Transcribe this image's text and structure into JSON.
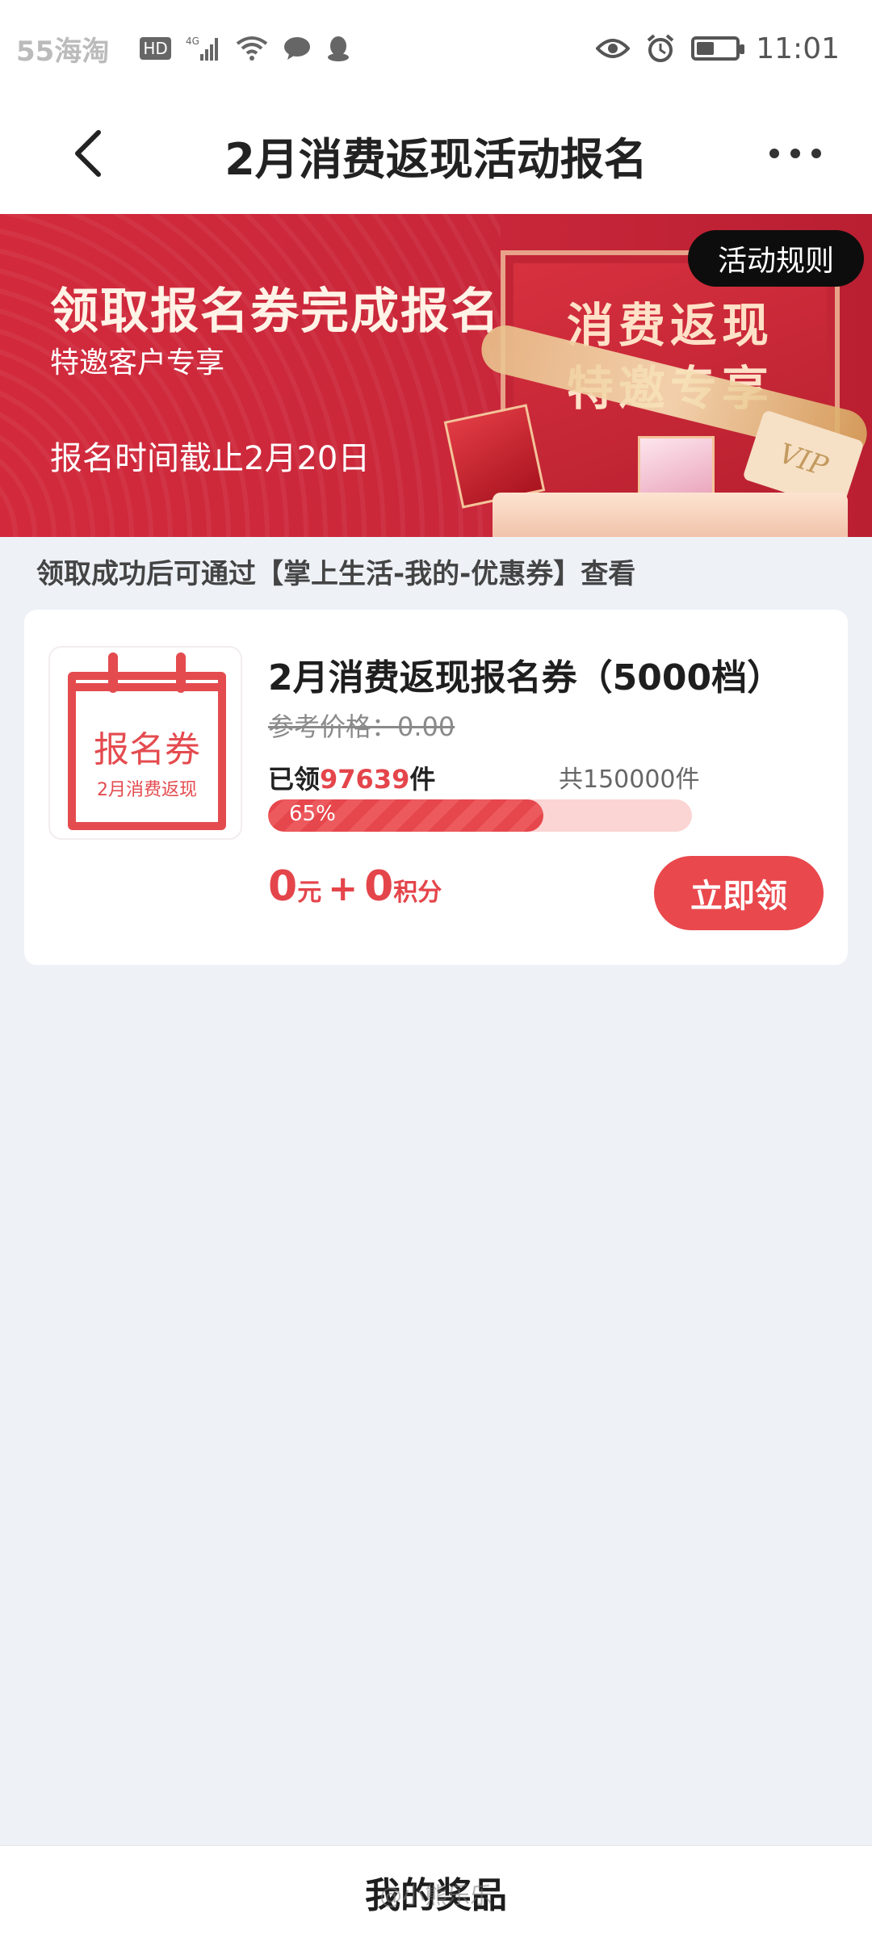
{
  "status_bar": {
    "watermark": "55海淘",
    "hd": "HD",
    "network": "4G",
    "time": "11:01",
    "battery_level": 0.45
  },
  "nav": {
    "title": "2月消费返现活动报名",
    "back_icon": "chevron-left-icon",
    "more_icon": "more-dots-icon"
  },
  "banner": {
    "headline": "领取报名券完成报名",
    "subtitle": "特邀客户专享",
    "deadline": "报名时间截止2月20日",
    "art_line1": "消费返现",
    "art_line2": "特邀专享",
    "vip_text": "VIP",
    "rules_button": "活动规则"
  },
  "note": "领取成功后可通过【掌上生活-我的-优惠券】查看",
  "coupon": {
    "image_title": "报名券",
    "image_subtitle": "2月消费返现",
    "title": "2月消费返现报名券（5000档）",
    "reference_price": "参考价格：0.00",
    "claimed_prefix": "已领",
    "claimed_count": "97639",
    "claimed_suffix": "件",
    "total": "共150000件",
    "progress_label": "65%",
    "progress_value": 0.65,
    "price_amount": "0",
    "price_unit": "元",
    "plus": "+",
    "points_amount": "0",
    "points_unit": "积分",
    "claim_button": "立即领"
  },
  "bottom": {
    "label": "我的奖品",
    "watermark": "@小熊乐乐"
  },
  "colors": {
    "accent": "#e9484d",
    "banner_red": "#d22a3c",
    "background": "#eef2f7"
  }
}
